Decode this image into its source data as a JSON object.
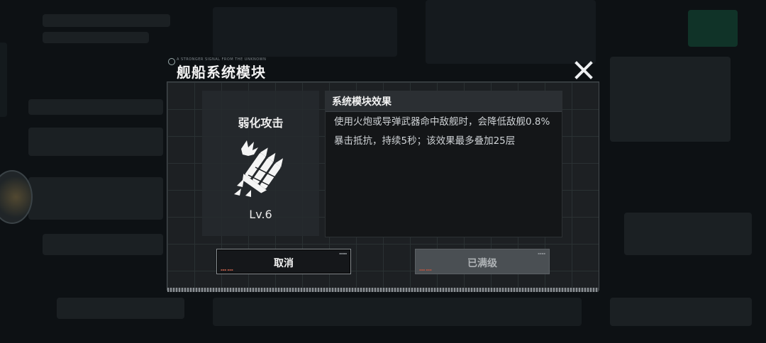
{
  "dialog": {
    "title": "舰船系统模块",
    "title_tag": "A STRONGER SIGNAL FROM THE UNKNOWN",
    "close_icon": "close-x-icon"
  },
  "module": {
    "name": "弱化攻击",
    "icon": "missile-barrage-icon",
    "level": "Lv.6"
  },
  "effect": {
    "heading": "系统模块效果",
    "description": "使用火炮或导弹武器命中敌舰时，会降低敌舰0.8%暴击抵抗，持续5秒；该效果最多叠加25层"
  },
  "buttons": {
    "cancel": "取消",
    "max_level": "已满级"
  },
  "colors": {
    "dialog_bg": "#1d2023",
    "cancel_border": "#8a8f93",
    "disabled_button": "#4a4f53"
  }
}
